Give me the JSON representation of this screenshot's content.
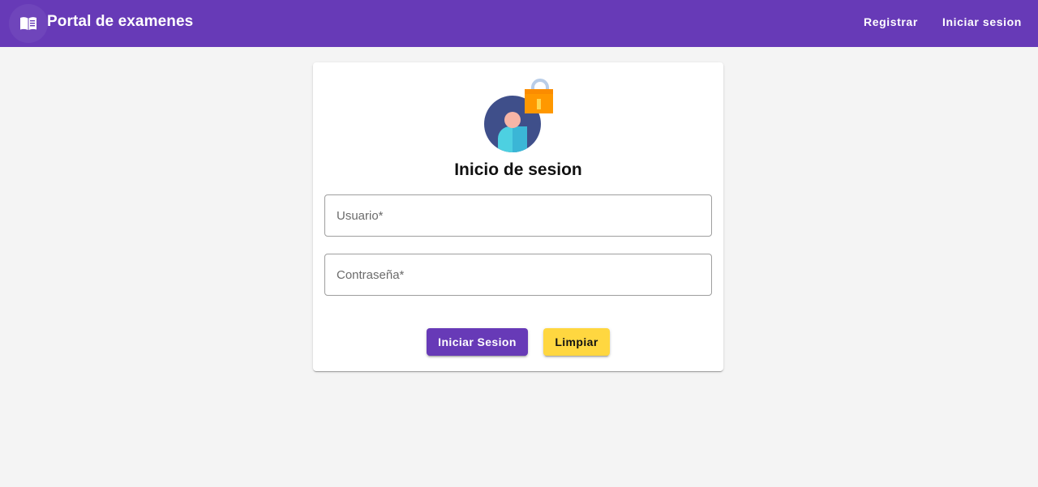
{
  "toolbar": {
    "menu_icon": "menu-book-icon",
    "title": "Portal de examenes",
    "nav": {
      "register_label": "Registrar",
      "login_label": "Iniciar sesion"
    }
  },
  "login_card": {
    "illustration": "user-lock-icon",
    "title": "Inicio de sesion",
    "username_placeholder": "Usuario*",
    "password_placeholder": "Contraseña*",
    "submit_label": "Iniciar Sesion",
    "clear_label": "Limpiar"
  },
  "colors": {
    "primary": "#673ab7",
    "accent": "#ffd740",
    "background": "#f4f4f4"
  }
}
